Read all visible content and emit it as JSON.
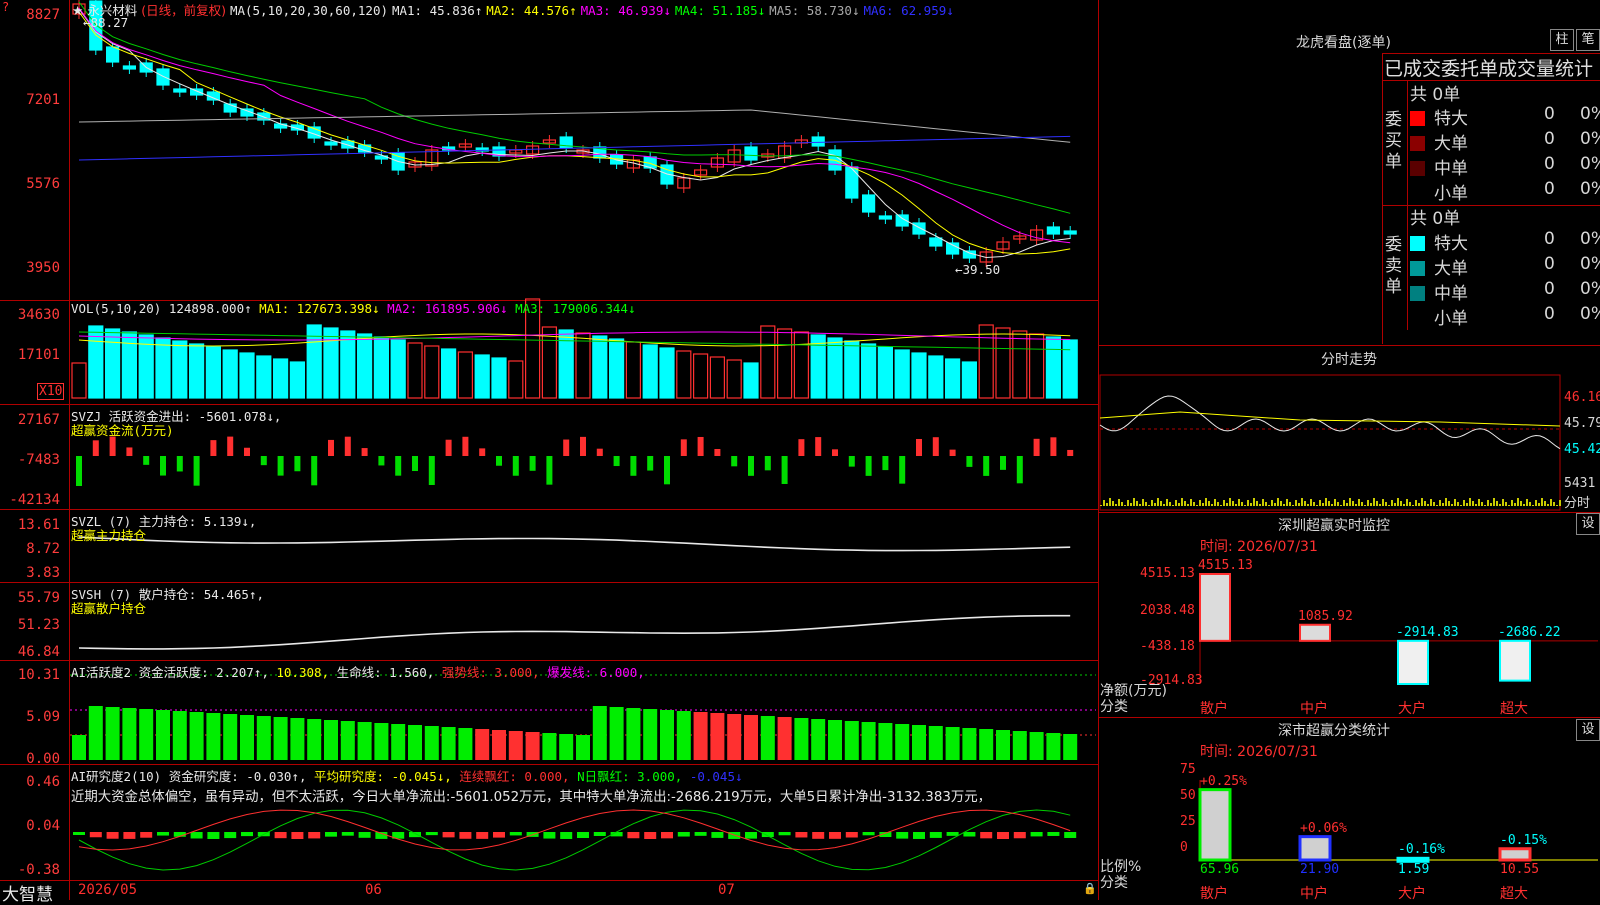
{
  "header": {
    "stock_name": "永兴材料",
    "period": "(日线，前复权)",
    "ma_label": "MA(5,10,20,30,60,120)",
    "ma1": "MA1: 45.836↑",
    "ma2": "MA2: 44.576↑",
    "ma3": "MA3: 46.939↓",
    "ma4": "MA4: 51.185↓",
    "ma5": "MA5: 58.730↓",
    "ma6": "MA6: 62.959↓",
    "high_mark": "←88.27",
    "low_mark": "←39.50"
  },
  "price_axis": [
    "8827",
    "7201",
    "5576",
    "3950"
  ],
  "volume": {
    "title": "VOL(5,10,20)",
    "value": "124898.000↑",
    "ma1": "MA1: 127673.398↓",
    "ma2": "MA2: 161895.906↓",
    "ma3": "MA3: 179006.344↓",
    "axis": [
      "34630",
      "17101"
    ],
    "unit": "X10"
  },
  "svzj": {
    "title": "SVZJ  活跃资金进出: -5601.078↓,",
    "subtitle": "超赢资金流(万元)",
    "axis": [
      "27167",
      "-7483",
      "-42134"
    ]
  },
  "svzl": {
    "title": "SVZL (7) 主力持仓: 5.139↓,",
    "subtitle": "超赢主力持仓",
    "axis": [
      "13.61",
      "8.72",
      "3.83"
    ]
  },
  "svsh": {
    "title": "SVSH (7) 散户持仓: 54.465↑,",
    "subtitle": "超赢散户持仓",
    "axis": [
      "55.79",
      "51.23",
      "46.84"
    ]
  },
  "ai_active": {
    "name": "AI活跃度2",
    "a": "资金活跃度: 2.207↑,",
    "b": "10.308,",
    "c": "生命线: 1.560,",
    "d": "强势线: 3.000,",
    "e": "爆发线: 6.000,",
    "axis": [
      "10.31",
      "5.09",
      "0.00"
    ]
  },
  "ai_research": {
    "name": "AI研究度2(10)",
    "a": "资金研究度: -0.030↑,",
    "b": "平均研究度: -0.045↓,",
    "c": "连续飘红: 0.000,",
    "d": "N日飘红: 3.000,",
    "e": "-0.045↓",
    "comment": "近期大资金总体偏空，虽有异动，但不太活跃，今日大单净流出:-5601.052万元，其中特大单净流出:-2686.219万元，大单5日累计净出-3132.383万元，",
    "axis": [
      "0.46",
      "0.04",
      "-0.38"
    ]
  },
  "bottom": {
    "brand": "大智慧",
    "dates": [
      "2026/05",
      "06",
      "07"
    ]
  },
  "longhu": {
    "title": "龙虎看盘(逐单)",
    "btn1": "柱",
    "btn2": "笔",
    "header": "已成交委托单成交量统计",
    "buy_label": "委买单",
    "sell_label": "委卖单",
    "buy_total": "共 0单",
    "sell_total": "共 0单",
    "buy_rows": [
      {
        "label": "特大",
        "count": "0",
        "pct": "0%",
        "color": "#ff0000"
      },
      {
        "label": "大单",
        "count": "0",
        "pct": "0%",
        "color": "#8b0000"
      },
      {
        "label": "中单",
        "count": "0",
        "pct": "0%",
        "color": "#5a0000"
      },
      {
        "label": "小单",
        "count": "0",
        "pct": "0%",
        "color": "#000000"
      }
    ],
    "sell_rows": [
      {
        "label": "特大",
        "count": "0",
        "pct": "0%",
        "color": "#00ffff"
      },
      {
        "label": "大单",
        "count": "0",
        "pct": "0%",
        "color": "#009999"
      },
      {
        "label": "中单",
        "count": "0",
        "pct": "0%",
        "color": "#008080"
      },
      {
        "label": "小单",
        "count": "0",
        "pct": "0%",
        "color": "#000000"
      }
    ]
  },
  "intraday": {
    "title": "分时走势",
    "axis": [
      "46.16",
      "45.79",
      "45.42"
    ],
    "vol": "5431",
    "vol_label": "分时"
  },
  "sz_monitor": {
    "title": "深圳超赢实时监控",
    "set": "设",
    "time": "时间: 2026/07/31",
    "axis": [
      "4515.13",
      "2038.48",
      "-438.18",
      "-2914.83"
    ],
    "ylabel": "净额(万元)",
    "xlabel": "分类",
    "categories": [
      "散户",
      "中户",
      "大户",
      "超大"
    ],
    "values": [
      "4515.13",
      "1085.92",
      "-2914.83",
      "-2686.22"
    ]
  },
  "sz_class": {
    "title": "深市超赢分类统计",
    "set": "设",
    "time": "时间: 2026/07/31",
    "axis": [
      "75",
      "50",
      "25",
      "0"
    ],
    "ylabel": "比例%",
    "xlabel": "分类",
    "categories": [
      "散户",
      "中户",
      "大户",
      "超大"
    ],
    "values": [
      "65.96",
      "21.90",
      "1.59",
      "10.55"
    ],
    "changes": [
      "+0.25%",
      "+0.06%",
      "-0.16%",
      "-0.15%"
    ]
  },
  "chart_data": {
    "type": "bar",
    "title": "深圳超赢实时监控",
    "ylabel": "净额(万元)",
    "xlabel": "分类",
    "categories": [
      "散户",
      "中户",
      "大户",
      "超大"
    ],
    "values": [
      4515.13,
      1085.92,
      -2914.83,
      -2686.22
    ],
    "ylim": [
      -2914.83,
      4515.13
    ]
  },
  "colors": {
    "up": "#ff3030",
    "down": "#00ffff",
    "grid": "#b00000"
  }
}
